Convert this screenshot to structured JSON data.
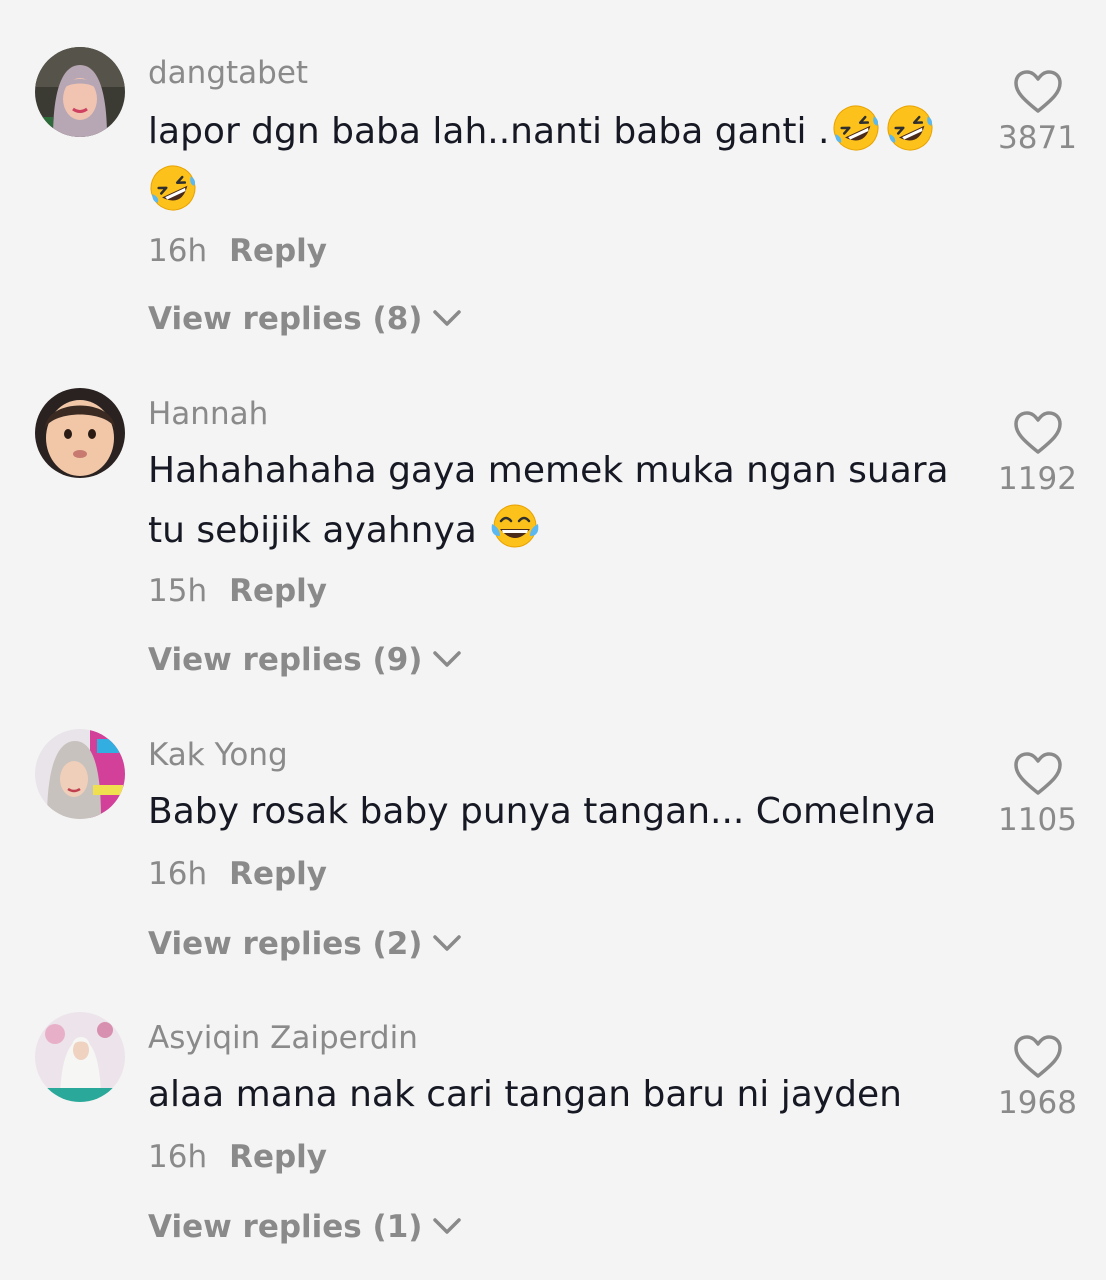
{
  "comments": [
    {
      "username": "dangtabet",
      "text": "lapor dgn baba lah..nanti baba ganti .",
      "emoji": "rolling-on-floor-laughing",
      "time": "16h",
      "reply_label": "Reply",
      "view_replies": "View replies (8)",
      "likes": "3871"
    },
    {
      "username": "Hannah",
      "text": "Hahahahaha gaya memek muka ngan suara tu sebijik ayahnya",
      "emoji": "face-with-tears-of-joy",
      "time": "15h",
      "reply_label": "Reply",
      "view_replies": "View replies (9)",
      "likes": "1192"
    },
    {
      "username": "Kak Yong",
      "text": "Baby rosak baby punya tangan... Comelnya",
      "time": "16h",
      "reply_label": "Reply",
      "view_replies": "View replies (2)",
      "likes": "1105"
    },
    {
      "username": "Asyiqin Zaiperdin",
      "text": "alaa mana nak cari tangan baru ni jayden",
      "time": "16h",
      "reply_label": "Reply",
      "view_replies": "View replies (1)",
      "likes": "1968"
    }
  ],
  "icons": {
    "like": "heart-outline-icon",
    "expand": "chevron-down-icon"
  },
  "colors": {
    "background": "#f4f4f4",
    "primary_text": "#161823",
    "secondary_text": "#8a8a8a"
  }
}
